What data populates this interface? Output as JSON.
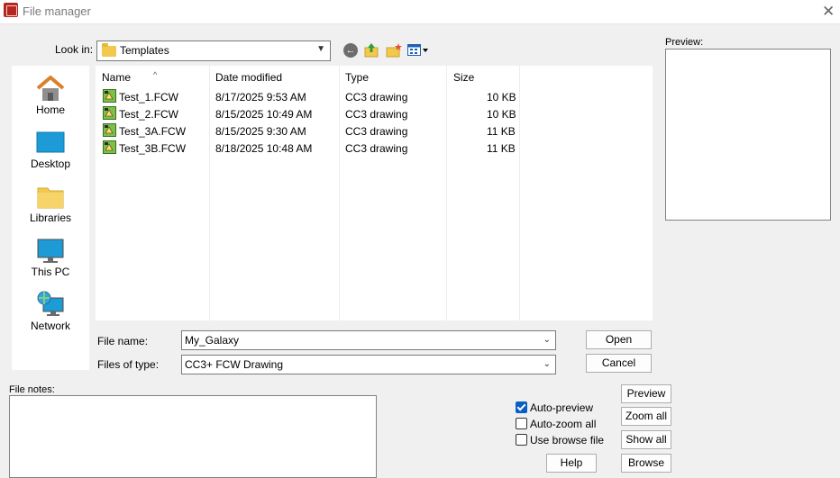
{
  "window": {
    "title": "File manager"
  },
  "lookin": {
    "label": "Look in:",
    "value": "Templates"
  },
  "places": [
    {
      "label": "Home",
      "icon": "home-icon"
    },
    {
      "label": "Desktop",
      "icon": "desktop-icon"
    },
    {
      "label": "Libraries",
      "icon": "libraries-icon"
    },
    {
      "label": "This PC",
      "icon": "computer-icon"
    },
    {
      "label": "Network",
      "icon": "network-icon"
    }
  ],
  "filelist": {
    "columns": [
      "Name",
      "Date modified",
      "Type",
      "Size"
    ],
    "rows": [
      {
        "name": "Test_1.FCW",
        "date": "8/17/2025 9:53 AM",
        "type": "CC3 drawing",
        "size": "10 KB"
      },
      {
        "name": "Test_2.FCW",
        "date": "8/15/2025 10:49 AM",
        "type": "CC3 drawing",
        "size": "10 KB"
      },
      {
        "name": "Test_3A.FCW",
        "date": "8/15/2025 9:30 AM",
        "type": "CC3 drawing",
        "size": "11 KB"
      },
      {
        "name": "Test_3B.FCW",
        "date": "8/18/2025 10:48 AM",
        "type": "CC3 drawing",
        "size": "11 KB"
      }
    ]
  },
  "filename": {
    "label": "File name:",
    "value": "My_Galaxy"
  },
  "filetype": {
    "label": "Files of type:",
    "value": "CC3+ FCW Drawing"
  },
  "buttons": {
    "open": "Open",
    "cancel": "Cancel",
    "preview": "Preview",
    "zoom_all": "Zoom all",
    "show_all": "Show all",
    "help": "Help",
    "browse": "Browse"
  },
  "preview": {
    "label": "Preview:"
  },
  "notes": {
    "label": "File notes:"
  },
  "options": {
    "auto_preview": {
      "label": "Auto-preview",
      "checked": true
    },
    "auto_zoom": {
      "label": "Auto-zoom all",
      "checked": false
    },
    "browse_file": {
      "label": "Use browse file",
      "checked": false
    }
  },
  "colors": {
    "accent": "#0a5fc2",
    "background": "#f0f0f0",
    "folder": "#f2c94c"
  }
}
